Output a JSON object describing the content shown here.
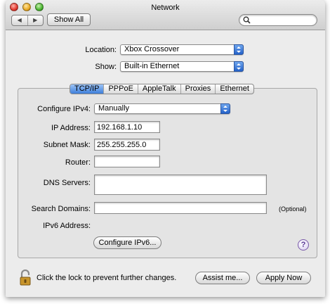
{
  "window": {
    "title": "Network"
  },
  "toolbar": {
    "back_glyph": "◀",
    "forward_glyph": "▶",
    "show_all_label": "Show All",
    "search_value": ""
  },
  "location": {
    "label": "Location:",
    "value": "Xbox Crossover"
  },
  "show": {
    "label": "Show:",
    "value": "Built-in Ethernet"
  },
  "tabs": [
    "TCP/IP",
    "PPPoE",
    "AppleTalk",
    "Proxies",
    "Ethernet"
  ],
  "active_tab": "TCP/IP",
  "tcpip": {
    "configure_ipv4": {
      "label": "Configure IPv4:",
      "value": "Manually"
    },
    "ip_address": {
      "label": "IP Address:",
      "value": "192.168.1.10"
    },
    "subnet_mask": {
      "label": "Subnet Mask:",
      "value": "255.255.255.0"
    },
    "router": {
      "label": "Router:",
      "value": ""
    },
    "dns_servers": {
      "label": "DNS Servers:",
      "value": ""
    },
    "search_domains": {
      "label": "Search Domains:",
      "value": "",
      "hint": "(Optional)"
    },
    "ipv6_address": {
      "label": "IPv6 Address:"
    },
    "configure_ipv6_label": "Configure IPv6...",
    "help_label": "?"
  },
  "footer": {
    "lock_text": "Click the lock to prevent further changes.",
    "assist_label": "Assist me...",
    "apply_label": "Apply Now"
  },
  "colors": {
    "accent": "#3d7ed9",
    "lock": "#c8952c"
  },
  "icons": [
    "search-icon",
    "lock-open-icon",
    "help-icon",
    "popup-arrows-icon"
  ]
}
